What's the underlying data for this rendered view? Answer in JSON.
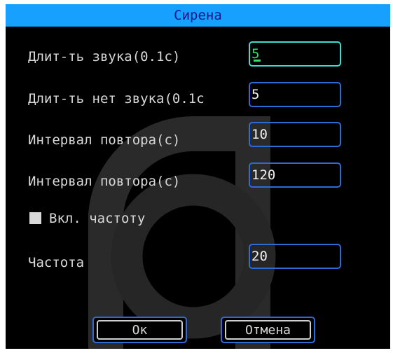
{
  "dialog": {
    "title": "Сирена"
  },
  "form": {
    "sound_duration": {
      "label": "Длит-ть звука(0.1с)",
      "value": "5"
    },
    "silence_duration": {
      "label": "Длит-ть нет звука(0.1с",
      "value": "5"
    },
    "repeat_interval_1": {
      "label": "Интервал повтора(с)",
      "value": "10"
    },
    "repeat_interval_2": {
      "label": "Интервал повтора(с)",
      "value": "120"
    },
    "enable_frequency": {
      "label": "Вкл. частоту",
      "checked": false
    },
    "frequency": {
      "label": "Частота",
      "value": "20"
    }
  },
  "buttons": {
    "ok": "Ок",
    "cancel": "Отмена"
  },
  "colors": {
    "title_bar": "#18a0ff",
    "field_border": "#2f6bd6",
    "focused_border": "#38e0d0",
    "focused_text": "#2ee06a"
  }
}
